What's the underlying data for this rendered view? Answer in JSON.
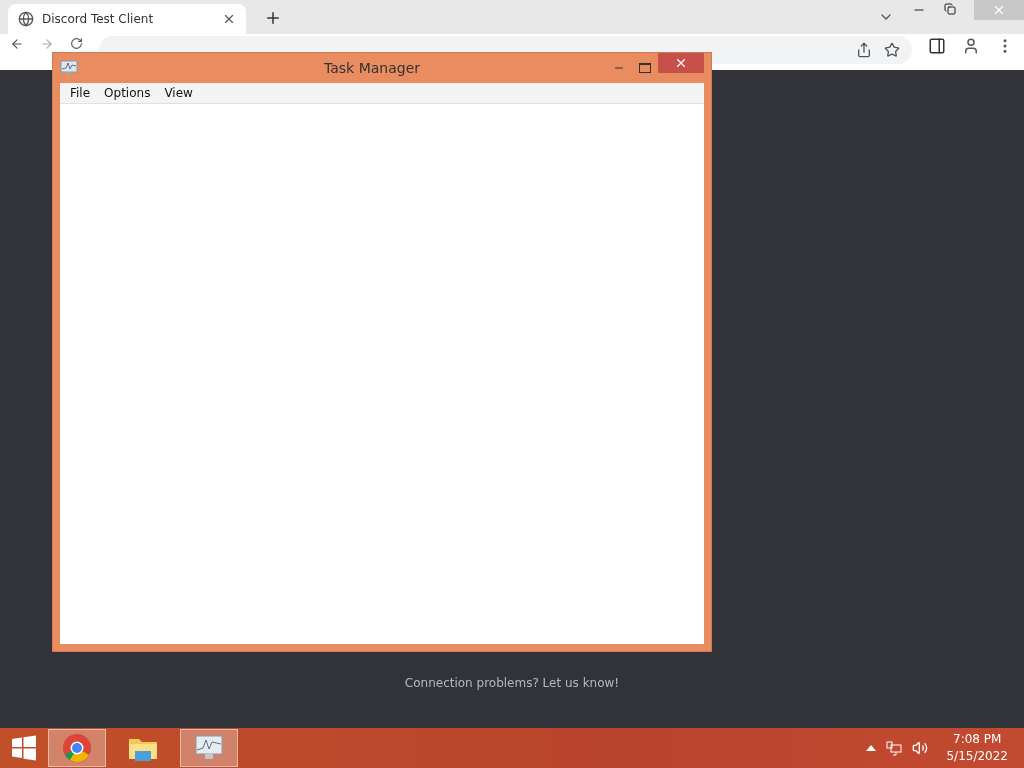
{
  "browser": {
    "tab": {
      "title": "Discord Test Client"
    }
  },
  "page": {
    "footer_text": "Connection problems? Let us know!"
  },
  "window": {
    "title": "Task Manager",
    "menu": [
      "File",
      "Options",
      "View"
    ]
  },
  "taskbar": {
    "apps": [
      {
        "kind": "chrome",
        "selected": true
      },
      {
        "kind": "folder",
        "selected": false
      },
      {
        "kind": "monitor",
        "selected": true
      }
    ],
    "time": "7:08 PM",
    "date": "5/15/2022"
  }
}
